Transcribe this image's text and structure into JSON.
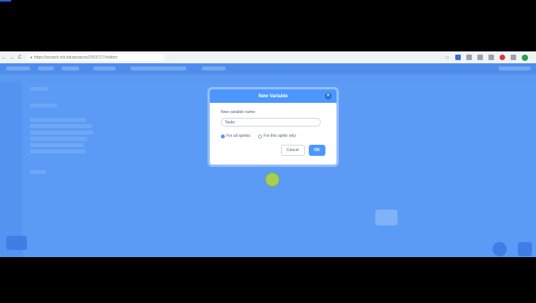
{
  "browser": {
    "url": "https://scratch.mit.edu/projects/2933717/#editor",
    "nav_back": "←",
    "nav_forward": "→",
    "nav_reload": "C",
    "lock": "●",
    "bookmark_star": "☆"
  },
  "dialog": {
    "title": "New Variable",
    "close": "×",
    "name_label": "New variable name:",
    "name_value": "Tasks",
    "option_all_sprites": "For all sprites",
    "option_this_sprite": "For this sprite only",
    "cancel_label": "Cancel",
    "ok_label": "OK"
  },
  "colors": {
    "accent": "#4c97ff",
    "dimmed_background": "#5b9bf5"
  }
}
